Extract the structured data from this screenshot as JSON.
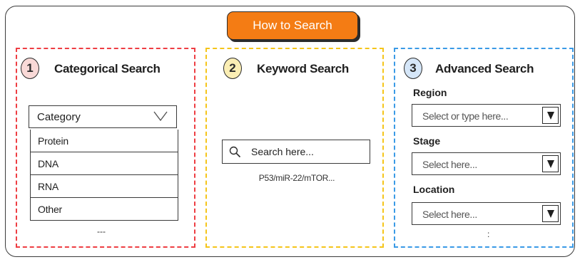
{
  "header": {
    "how_to_search_label": "How to Search"
  },
  "panels": {
    "categorical": {
      "step": "1",
      "title": "Categorical Search",
      "dropdown_value": "Category",
      "options": [
        "Protein",
        "DNA",
        "RNA",
        "Other"
      ],
      "more": "---"
    },
    "keyword": {
      "step": "2",
      "title": "Keyword Search",
      "placeholder": "Search here...",
      "hint": "P53/miR-22/mTOR..."
    },
    "advanced": {
      "step": "3",
      "title": "Advanced Search",
      "fields": [
        {
          "label": "Region",
          "placeholder": "Select or type here..."
        },
        {
          "label": "Stage",
          "placeholder": "Select here..."
        },
        {
          "label": "Location",
          "placeholder": "Select here..."
        }
      ],
      "more": ":"
    }
  },
  "colors": {
    "accent_button": "#f47c14",
    "panel1_border": "#ee3e43",
    "panel2_border": "#f5c51a",
    "panel3_border": "#3a9ae6"
  },
  "icons": [
    "search-icon",
    "chevron-down-icon",
    "dropdown-arrow-icon"
  ]
}
